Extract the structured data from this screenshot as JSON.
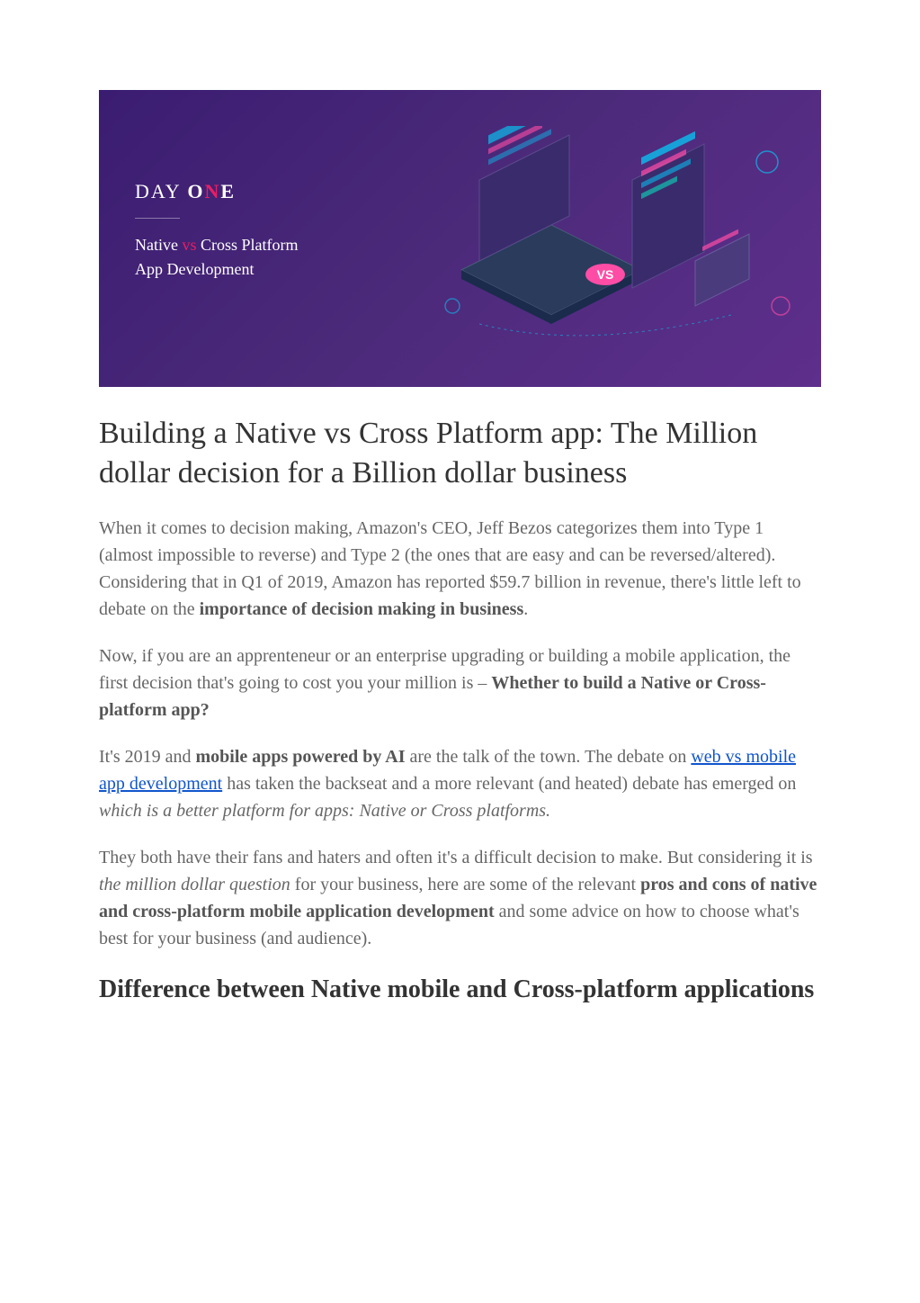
{
  "banner": {
    "logo_part1": "DAY ",
    "logo_part2": "O",
    "logo_accent": "N",
    "logo_part3": "E",
    "subtitle_part1": "Native ",
    "subtitle_vs": "vs",
    "subtitle_part2": " Cross Platform",
    "subtitle_line2": "App Development"
  },
  "article": {
    "title": "Building a Native vs Cross Platform app: The Million dollar decision for a Billion dollar business",
    "p1_part1": "When it comes to decision making, Amazon's CEO, Jeff Bezos categorizes them into Type 1 (almost impossible to reverse) and Type 2 (the ones that are easy and can be reversed/altered). Considering that in Q1 of 2019, Amazon has reported $59.7 billion in revenue, there's little left to debate on the ",
    "p1_bold": "importance of decision making in business",
    "p1_part2": ".",
    "p2_part1": "Now, if you are an apprenteneur or an enterprise upgrading or building a mobile application, the first decision that's going to cost you your million is – ",
    "p2_bold": "Whether to build a Native or Cross-platform app?",
    "p3_part1": "It's 2019 and ",
    "p3_bold1": "mobile apps powered by AI",
    "p3_part2": " are the talk of the town. The debate on ",
    "p3_link": "web vs mobile app development",
    "p3_part3": " has taken the backseat and a more relevant (and heated) debate has emerged on ",
    "p3_italic": "which is a better platform for apps: Native or Cross platforms.",
    "p4_part1": "They both have their fans and haters and often it's a difficult decision to make. But considering it is ",
    "p4_italic": "the million dollar question",
    "p4_part2": " for your business, here are some of the relevant ",
    "p4_bold": "pros and cons of native and cross-platform mobile application development",
    "p4_part3": " and some advice on how to choose what's best for your business (and audience).",
    "h2": "Difference between Native mobile and Cross-platform applications"
  }
}
